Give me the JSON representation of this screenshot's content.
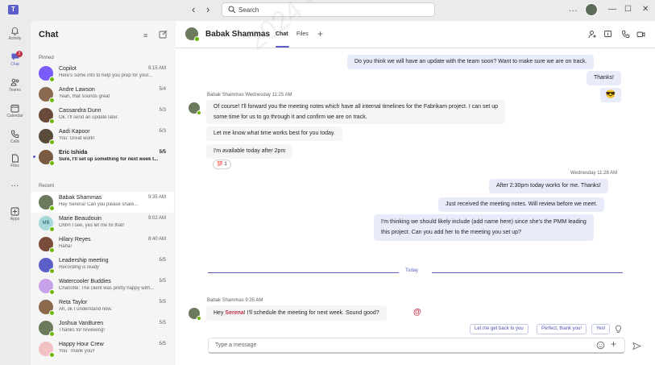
{
  "titlebar": {
    "app_icon_name": "teams-logo-icon",
    "app_icon_glyph": "T",
    "search_placeholder": "Search",
    "more_glyph": "...",
    "minimize_glyph": "—",
    "maximize_glyph": "☐",
    "close_glyph": "✕"
  },
  "rail": {
    "items": [
      {
        "label": "Activity",
        "icon": "bell-icon"
      },
      {
        "label": "Chat",
        "icon": "chat-icon",
        "badge": "2"
      },
      {
        "label": "Teams",
        "icon": "people-icon"
      },
      {
        "label": "Calendar",
        "icon": "calendar-icon"
      },
      {
        "label": "Calls",
        "icon": "phone-icon"
      },
      {
        "label": "Files",
        "icon": "file-icon"
      },
      {
        "label": "",
        "icon": "more-icon"
      },
      {
        "label": "Apps",
        "icon": "apps-icon"
      }
    ],
    "more_glyph": "···"
  },
  "chat_list": {
    "title": "Chat",
    "pinned_label": "Pinned",
    "recent_label": "Recent",
    "pinned": [
      {
        "name": "Copilot",
        "preview": "Here's some info to help you prep for your...",
        "time": "9:15 AM",
        "avatar_color": "#7a5af8",
        "bold": false
      },
      {
        "name": "Andre Lawson",
        "preview": "Yeah, that sounds great",
        "time": "5/4",
        "avatar_color": "#8a6a50",
        "bold": false
      },
      {
        "name": "Cassandra Dunn",
        "preview": "Ok. I'll send an update later.",
        "time": "5/3",
        "avatar_color": "#6a4a3a",
        "bold": false
      },
      {
        "name": "Aadi Kapoor",
        "preview": "You: Great work!",
        "time": "5/3",
        "avatar_color": "#5a4a3a",
        "bold": false
      },
      {
        "name": "Eric Ishida",
        "preview": "Sure, I'll set up something for next week t...",
        "time": "5/5",
        "avatar_color": "#7a5a40",
        "bold": true
      }
    ],
    "recent": [
      {
        "name": "Babak Shammas",
        "preview": "Hey Serena! Can you please share...",
        "time": "9:35 AM",
        "avatar_color": "#6b7a5d",
        "bold": false,
        "selected": true
      },
      {
        "name": "Marie Beaudouin",
        "preview": "Ohhh I see, yes let me fix that!",
        "time": "9:02 AM",
        "avatar_color": "#a7d8d8",
        "initials": "MB",
        "bold": false
      },
      {
        "name": "Hilary Reyes",
        "preview": "Haha!",
        "time": "8:40 AM",
        "avatar_color": "#7a4a3a",
        "bold": false
      },
      {
        "name": "Leadership meeting",
        "preview": "Recording is ready",
        "time": "5/5",
        "avatar_color": "#5b5fc7",
        "bold": false,
        "italic": true
      },
      {
        "name": "Watercooler Buddies",
        "preview": "Charlotte: The client was pretty happy with...",
        "time": "5/5",
        "avatar_color": "#c8a2e8",
        "bold": false
      },
      {
        "name": "Reta Taylor",
        "preview": "Ah, ok I understand now.",
        "time": "5/5",
        "avatar_color": "#8a6a4a",
        "bold": false
      },
      {
        "name": "Joshua VanBuren",
        "preview": "Thanks for reviewing!",
        "time": "5/5",
        "avatar_color": "#6a7a5a",
        "bold": false
      },
      {
        "name": "Happy Hour Crew",
        "preview": "You: Thank you!!",
        "time": "5/5",
        "avatar_color": "#f2c1c1",
        "bold": false
      }
    ]
  },
  "conversation": {
    "contact_name": "Babak Shammas",
    "tabs": [
      "Chat",
      "Files"
    ],
    "active_tab": "Chat",
    "messages_me_1": [
      "Do you think we will have an update with the team soon? Want to make sure we are on track.",
      "Thanks!"
    ],
    "emoji_message": "😎",
    "them_meta": "Babak Shammas   Wednesday 11:25 AM",
    "them_1": [
      "Of course! I'll forward you the meeting notes which have all internal timelines for the Fabrikam project. I can set up",
      "some time for us to go through it and confirm we are on track.",
      "Let me know what time works best for you today.",
      "I'm available today after 2pm"
    ],
    "reaction": "💯 1",
    "me_meta": "Wednesday 11:28 AM",
    "me_2": [
      "After 2:30pm today works for me. Thanks!",
      "Just received the meeting notes. Will review before we meet.",
      "I'm thinking we should likely include (add name here) since she's the PMM leading",
      "this project. Can you add her to the meeting you set up?"
    ],
    "divider_label": "Today",
    "last_meta": "Babak Shammas   9:35 AM",
    "last_prefix": "Hey ",
    "last_mention": "Serena",
    "last_suffix": "! I'll schedule the meeting for next week. Sound good?",
    "at_glyph": "@",
    "suggestions": [
      "Let me get back to you",
      "Perfect, thank you!",
      "Yes!"
    ],
    "compose_placeholder": "Type a message",
    "compose_plus": "+",
    "header_plus": "+"
  },
  "watermark": "2024 - 22 - AbdElRahman Basiony - SS"
}
